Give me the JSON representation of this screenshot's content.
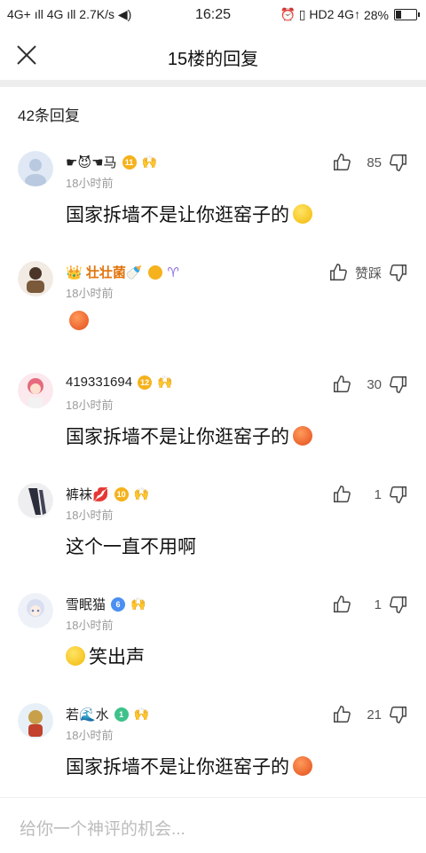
{
  "status_bar": {
    "left": "4G+ ıll 4G ıll 2.7K/s ◀)",
    "time": "16:25",
    "right": "⏰ ▯ HD2 4G↑",
    "battery": "28%",
    "battery_level": 0.28
  },
  "header": {
    "title": "15楼的回复",
    "close_icon": "close-icon"
  },
  "reply_count": "42条回复",
  "comments": [
    {
      "name": "☛😈☚马",
      "badge": "11",
      "time": "18小时前",
      "text": "国家拆墙不是让你逛窑子的",
      "emoji": "yellow",
      "likes": "85"
    },
    {
      "name": "👑 壮壮菌🍼",
      "badge": "",
      "extra": "♈",
      "time": "18小时前",
      "text": "",
      "emoji": "red",
      "likes": "赞踩"
    },
    {
      "name": "419331694",
      "badge": "12",
      "time": "18小时前",
      "text": "国家拆墙不是让你逛窑子的",
      "emoji": "red",
      "likes": "30"
    },
    {
      "name": "裤袜💋",
      "badge": "10",
      "time": "18小时前",
      "text": "这个一直不用啊",
      "emoji": "",
      "likes": "1"
    },
    {
      "name": "雪眠猫",
      "badge": "6",
      "time": "18小时前",
      "text": "笑出声",
      "emoji": "yellow",
      "likes": "1"
    },
    {
      "name": "若🌊水",
      "badge": "1",
      "time": "18小时前",
      "text": "国家拆墙不是让你逛窑子的",
      "emoji": "red",
      "likes": "21"
    }
  ],
  "footer": {
    "placeholder": "给你一个神评的机会..."
  },
  "colors": {
    "gold_name": "#e2740c",
    "time_gray": "#9a9a9a",
    "badge_gold": "#f5b21c",
    "badge_blue": "#4a8ff1",
    "badge_green": "#3fc28a"
  }
}
